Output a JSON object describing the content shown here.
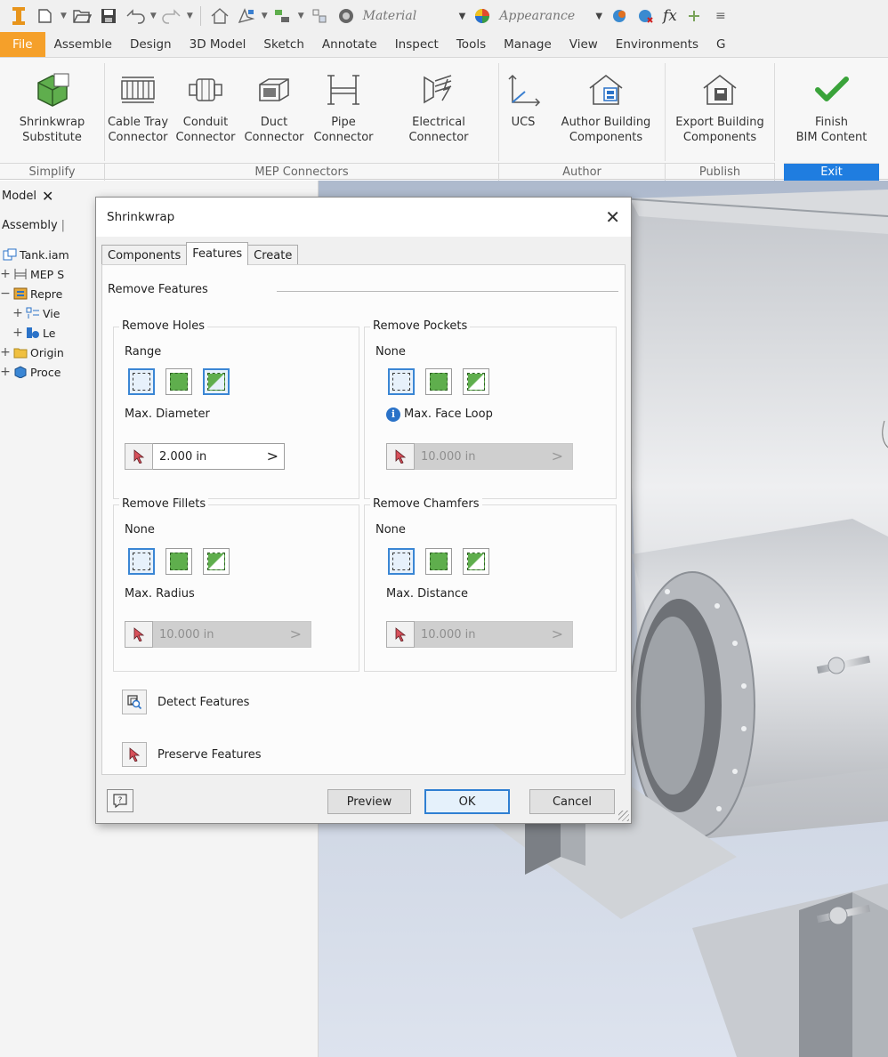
{
  "quick_access": {
    "material_value": "Material",
    "appearance_value": "Appearance",
    "fx_label": "fx"
  },
  "menu": {
    "tabs": [
      "File",
      "Assemble",
      "Design",
      "3D Model",
      "Sketch",
      "Annotate",
      "Inspect",
      "Tools",
      "Manage",
      "View",
      "Environments",
      "G"
    ]
  },
  "ribbon": {
    "buttons": [
      {
        "line1": "Shrinkwrap",
        "line2": "Substitute"
      },
      {
        "line1": "Cable Tray",
        "line2": "Connector"
      },
      {
        "line1": "Conduit",
        "line2": "Connector"
      },
      {
        "line1": "Duct",
        "line2": "Connector"
      },
      {
        "line1": "Pipe",
        "line2": "Connector"
      },
      {
        "line1": "Electrical",
        "line2": "Connector"
      },
      {
        "line1": "UCS",
        "line2": ""
      },
      {
        "line1": "Author Building",
        "line2": "Components"
      },
      {
        "line1": "Export Building",
        "line2": "Components"
      },
      {
        "line1": "Finish",
        "line2": "BIM Content"
      }
    ],
    "groups": [
      "Simplify",
      "MEP Connectors",
      "Author",
      "Publish",
      "Exit"
    ],
    "colors": {
      "exit": "#1f7de0",
      "file_tab": "#f5a02a",
      "check": "#3aa33a"
    }
  },
  "browser": {
    "tab_label": "Model",
    "assembly_label": "Assembly",
    "tree": [
      {
        "label": "Tank.iam",
        "pm": ""
      },
      {
        "label": "MEP S",
        "pm": "+"
      },
      {
        "label": "Repre",
        "pm": "−"
      },
      {
        "label": "Vie",
        "pm": "+"
      },
      {
        "label": "Le",
        "pm": "+"
      },
      {
        "label": "Origin",
        "pm": "+"
      },
      {
        "label": "Proce",
        "pm": "+"
      }
    ]
  },
  "dialog": {
    "title": "Shrinkwrap",
    "tabs": [
      "Components",
      "Features",
      "Create"
    ],
    "active_tab": "Features",
    "section_title": "Remove Features",
    "holes": {
      "legend": "Remove Holes",
      "mode": "Range",
      "caption": "Max. Diameter",
      "value": "2.000 in"
    },
    "pockets": {
      "legend": "Remove Pockets",
      "mode": "None",
      "caption": "Max. Face Loop",
      "value": "10.000 in"
    },
    "fillets": {
      "legend": "Remove Fillets",
      "mode": "None",
      "caption": "Max. Radius",
      "value": "10.000 in"
    },
    "chamfers": {
      "legend": "Remove Chamfers",
      "mode": "None",
      "caption": "Max. Distance",
      "value": "10.000 in"
    },
    "detect_label": "Detect Features",
    "preserve_label": "Preserve Features",
    "preview_label": "Preview",
    "ok_label": "OK",
    "cancel_label": "Cancel",
    "more_glyph": ">",
    "help_glyph": "?"
  }
}
